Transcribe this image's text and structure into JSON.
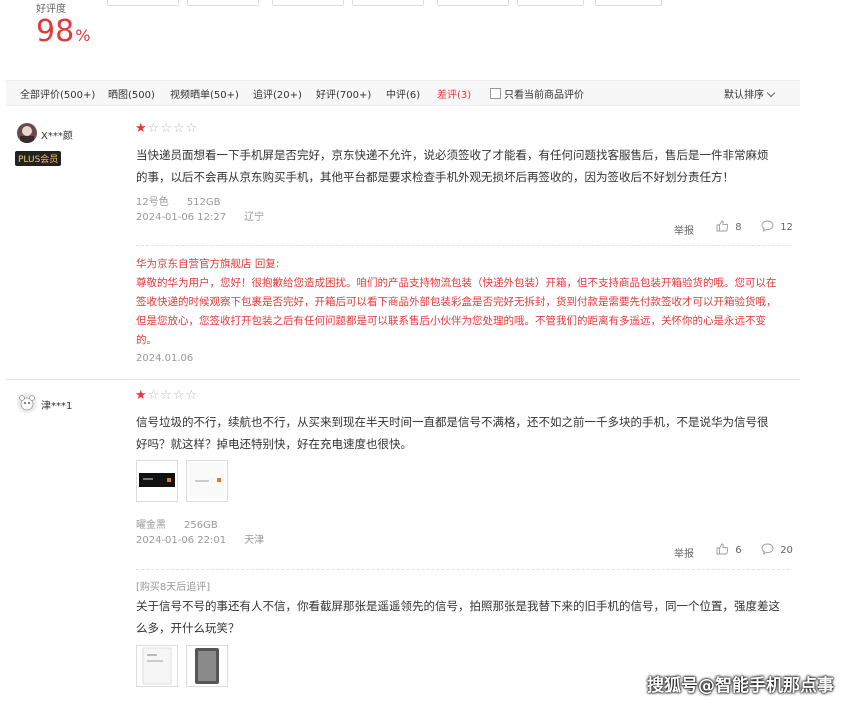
{
  "summary": {
    "rate_label": "好评度",
    "rate_value": "98",
    "rate_unit": "%"
  },
  "filters": [
    {
      "label": "全部评价(500+)"
    },
    {
      "label": "晒图(500)"
    },
    {
      "label": "视频晒单(50+)"
    },
    {
      "label": "追评(20+)"
    },
    {
      "label": "好评(700+)"
    },
    {
      "label": "中评(6)"
    },
    {
      "label": "差评(3)",
      "active": true
    }
  ],
  "current_only_label": "只看当前商品评价",
  "sort_label": "默认排序",
  "colors": {
    "accent": "#e4393c",
    "text": "#333333",
    "muted": "#999999"
  },
  "reviews": [
    {
      "user": "X***颜",
      "badge": "PLUS会员",
      "rating": "1/5",
      "content": "当快递员面想看一下手机屏是否完好，京东快递不允许，说必须签收了才能看，有任何问题找客服售后，售后是一件非常麻烦的事，以后不会再从京东购买手机，其他平台都是要求检查手机外观无损坏后再签收的，因为签收后不好划分责任方！",
      "color": "12号色",
      "storage": "512GB",
      "date": "2024-01-06 12:27",
      "region": "辽宁",
      "report": "举报",
      "likes": "8",
      "comments": "12",
      "reply_title": "华为京东自营官方旗舰店 回复:",
      "reply": "尊敬的华为用户，您好！很抱歉给您造成困扰。咱们的产品支持物流包装（快递外包装）开箱，但不支持商品包装开箱验货的哦。您可以在签收快递的时候观察下包裹是否完好，开箱后可以看下商品外部包装彩盒是否完好无拆封，货到付款是需要先付款签收才可以开箱验货哦，但是您放心，您签收打开包装之后有任何问题都是可以联系售后小伙伴为您处理的哦。不管我们的距离有多遥远，关怀你的心是永远不变的。",
      "reply_date": "2024.01.06"
    },
    {
      "user": "津***1",
      "rating": "1/5",
      "content": "信号垃圾的不行，续航也不行，从买来到现在半天时间一直都是信号不满格，还不如之前一千多块的手机，不是说华为信号很好吗？就这样？掉电还特别快，好在充电速度也很快。",
      "color": "曜金黑",
      "storage": "256GB",
      "date": "2024-01-06 22:01",
      "region": "天津",
      "report": "举报",
      "likes": "6",
      "comments": "20",
      "followup_tag": "[购买8天后追评]",
      "followup": "关于信号不号的事还有人不信，你看截屏那张是遥遥领先的信号，拍照那张是我替下来的旧手机的信号，同一个位置，强度差这么多，开什么玩笑？"
    }
  ],
  "watermark": "搜狐号@智能手机那点事"
}
